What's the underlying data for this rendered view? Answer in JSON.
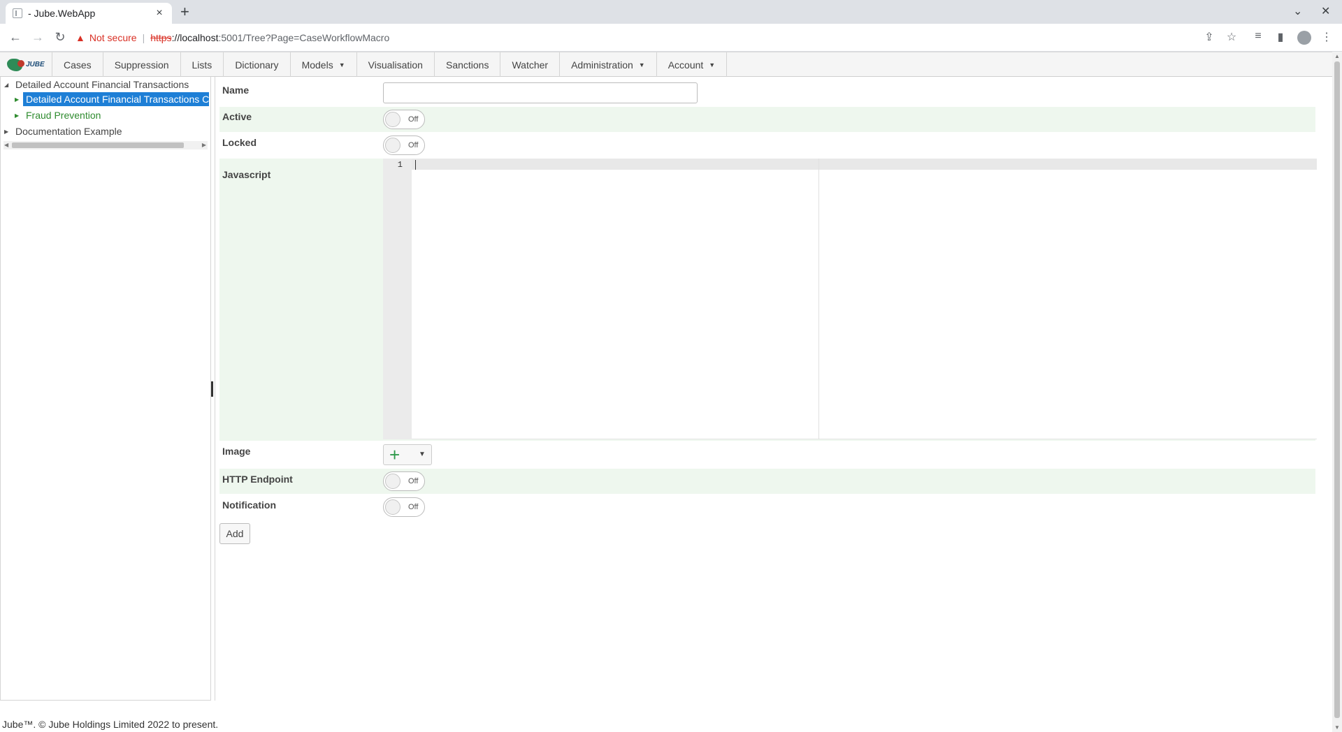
{
  "browser": {
    "tab_title": "- Jube.WebApp",
    "tab_close": "×",
    "new_tab": "+",
    "minimize": "⌄",
    "close_window": "✕",
    "not_secure": "Not secure",
    "url_scheme": "https",
    "url_host": "://localhost",
    "url_path": ":5001/Tree?Page=CaseWorkflowMacro"
  },
  "nav": {
    "logo_text": "JUBE",
    "items": [
      {
        "label": "Cases"
      },
      {
        "label": "Suppression"
      },
      {
        "label": "Lists"
      },
      {
        "label": "Dictionary"
      },
      {
        "label": "Models",
        "dropdown": true
      },
      {
        "label": "Visualisation"
      },
      {
        "label": "Sanctions"
      },
      {
        "label": "Watcher"
      },
      {
        "label": "Administration",
        "dropdown": true
      },
      {
        "label": "Account",
        "dropdown": true
      }
    ]
  },
  "tree": {
    "root1": "Detailed Account Financial Transactions",
    "child_selected": "Detailed Account Financial Transactions C",
    "child2": "Fraud Prevention",
    "root2": "Documentation Example"
  },
  "form": {
    "name_label": "Name",
    "name_value": "",
    "active_label": "Active",
    "active_state": "Off",
    "locked_label": "Locked",
    "locked_state": "Off",
    "javascript_label": "Javascript",
    "line_number": "1",
    "image_label": "Image",
    "http_endpoint_label": "HTTP Endpoint",
    "http_endpoint_state": "Off",
    "notification_label": "Notification",
    "notification_state": "Off",
    "add_button": "Add"
  },
  "footer": {
    "text": "Jube™. © Jube Holdings Limited 2022 to present."
  }
}
